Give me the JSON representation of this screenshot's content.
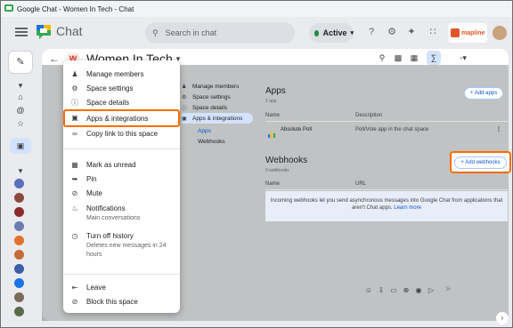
{
  "window": {
    "title": "Google Chat - Women In Tech - Chat"
  },
  "app": {
    "name": "Chat"
  },
  "search": {
    "placeholder": "Search in chat"
  },
  "status": {
    "label": "Active"
  },
  "brand_badge": {
    "label": "mapline"
  },
  "space": {
    "title": "Women In Tech",
    "avatar_letter": "W"
  },
  "menu": {
    "items": [
      {
        "label": "Manage members"
      },
      {
        "label": "Space settings"
      },
      {
        "label": "Space details"
      },
      {
        "label": "Apps & integrations"
      },
      {
        "label": "Copy link to this space"
      },
      {
        "label": "Mark as unread"
      },
      {
        "label": "Pin"
      },
      {
        "label": "Mute"
      },
      {
        "label": "Notifications",
        "sub": "Main conversations"
      },
      {
        "label": "Turn off history",
        "sub": "Deletes new messages in 24 hours"
      },
      {
        "label": "Leave"
      },
      {
        "label": "Block this space"
      }
    ]
  },
  "settings_nav": {
    "items": [
      {
        "label": "Manage members"
      },
      {
        "label": "Space settings"
      },
      {
        "label": "Space details"
      },
      {
        "label": "Apps & integrations"
      },
      {
        "label": "Apps"
      },
      {
        "label": "Webhooks"
      }
    ]
  },
  "apps": {
    "heading": "Apps",
    "count": "1 app",
    "add_button": "+ Add apps",
    "col_name": "Name",
    "col_description": "Description",
    "rows": [
      {
        "name": "Absolute Poll",
        "description": "Poll/Vote app in the chat space"
      }
    ]
  },
  "webhooks": {
    "heading": "Webhooks",
    "count": "0 webhooks",
    "add_button": "+ Add webhooks",
    "col_name": "Name",
    "col_url": "URL",
    "empty_text": "Incoming webhooks let you send asynchronous messages into Google Chat from applications that aren't Chat apps.",
    "learn_more": "Learn more"
  },
  "colors": {
    "accent": "#0b57d0",
    "highlight": "#ff6d00",
    "active_green": "#1e8e3e"
  }
}
